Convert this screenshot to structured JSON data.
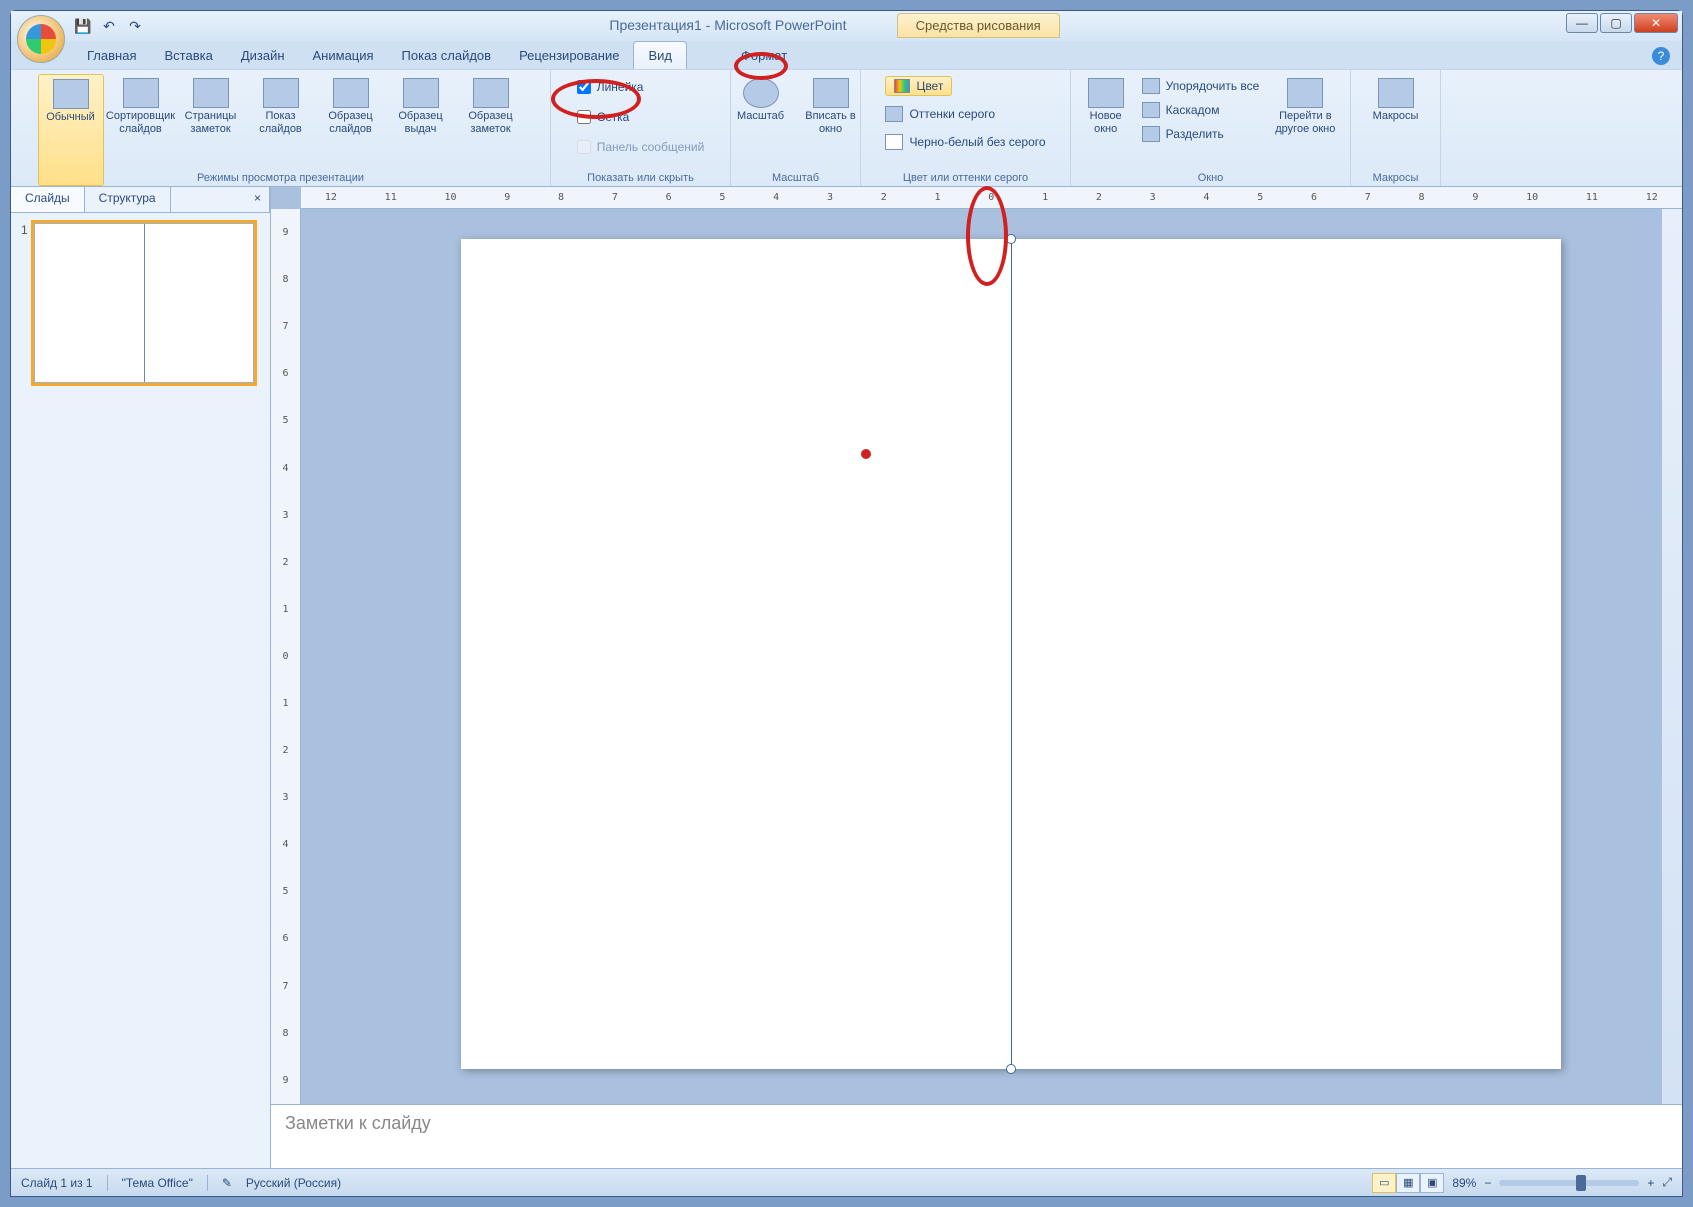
{
  "title": "Презентация1 - Microsoft PowerPoint",
  "context_tab": "Средства рисования",
  "qat": {
    "save": "💾",
    "undo": "↶",
    "redo": "↷"
  },
  "tabs": {
    "home": "Главная",
    "insert": "Вставка",
    "design": "Дизайн",
    "anim": "Анимация",
    "show": "Показ слайдов",
    "review": "Рецензирование",
    "view": "Вид",
    "format": "Формат"
  },
  "ribbon": {
    "views": {
      "normal": "Обычный",
      "sorter": "Сортировщик слайдов",
      "notes_page": "Страницы заметок",
      "slideshow": "Показ слайдов",
      "slide_master": "Образец слайдов",
      "handout_master": "Образец выдач",
      "notes_master": "Образец заметок",
      "group": "Режимы просмотра презентации"
    },
    "showhide": {
      "ruler": "Линейка",
      "grid": "Сетка",
      "msgbar": "Панель сообщений",
      "group": "Показать или скрыть"
    },
    "zoom": {
      "zoom": "Масштаб",
      "fit": "Вписать в окно",
      "group": "Масштаб"
    },
    "colorgray": {
      "color": "Цвет",
      "grayscale": "Оттенки серого",
      "bw": "Черно-белый без серого",
      "group": "Цвет или оттенки серого"
    },
    "window": {
      "new": "Новое окно",
      "arrange": "Упорядочить все",
      "cascade": "Каскадом",
      "split": "Разделить",
      "switch": "Перейти в другое окно",
      "group": "Окно"
    },
    "macros": {
      "macros": "Макросы",
      "group": "Макросы"
    }
  },
  "side": {
    "slides": "Слайды",
    "outline": "Структура",
    "close": "×"
  },
  "ruler_marks": [
    "12",
    "11",
    "10",
    "9",
    "8",
    "7",
    "6",
    "5",
    "4",
    "3",
    "2",
    "1",
    "0",
    "1",
    "2",
    "3",
    "4",
    "5",
    "6",
    "7",
    "8",
    "9",
    "10",
    "11",
    "12"
  ],
  "vruler_marks": [
    "9",
    "8",
    "7",
    "6",
    "5",
    "4",
    "3",
    "2",
    "1",
    "0",
    "1",
    "2",
    "3",
    "4",
    "5",
    "6",
    "7",
    "8",
    "9"
  ],
  "notes_placeholder": "Заметки к слайду",
  "status": {
    "slide": "Слайд 1 из 1",
    "theme": "\"Тема Office\"",
    "lang": "Русский (Россия)",
    "zoom_value": "89%",
    "zoom_out": "−",
    "zoom_in": "+",
    "fit": "⤢"
  }
}
